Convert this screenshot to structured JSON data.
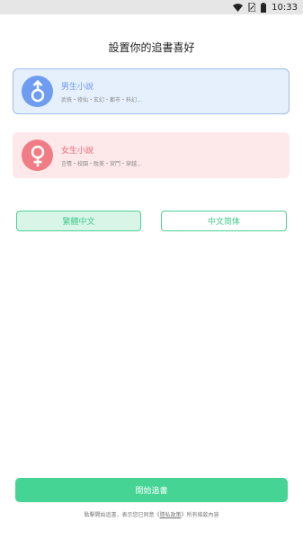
{
  "status_bar": {
    "time": "10:33",
    "icons": [
      "wifi-icon",
      "sim-icon",
      "battery-icon"
    ]
  },
  "title": "設置你的追書喜好",
  "options": [
    {
      "title": "男生小說",
      "subtitle": "武俠・修仙・玄幻・都市・科幻...",
      "icon": "male-icon",
      "selected": true
    },
    {
      "title": "女生小說",
      "subtitle": "言情・校園・耽美・宮鬥・穿越...",
      "icon": "female-icon",
      "selected": false
    }
  ],
  "language": {
    "traditional": "繁體中文",
    "simplified": "中文简体",
    "selected": "traditional"
  },
  "start_button": "開始追書",
  "footer": {
    "prefix": "點擊開始追書，表示您已同意《",
    "link": "隱私政策",
    "suffix": "》所有條款內容"
  },
  "colors": {
    "accent": "#45d494",
    "male": "#6e9cf0",
    "female": "#f07d85"
  }
}
